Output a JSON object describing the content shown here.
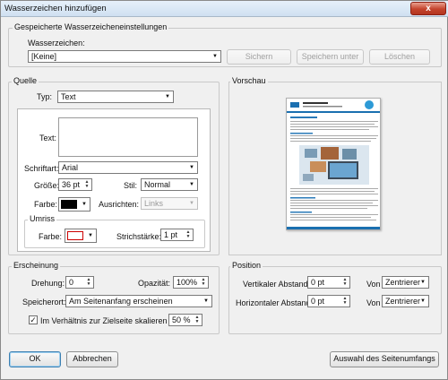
{
  "window": {
    "title": "Wasserzeichen hinzufügen",
    "close_glyph": "x"
  },
  "saved_settings": {
    "legend": "Gespeicherte Wasserzeicheneinstellungen",
    "watermark_label": "Wasserzeichen:",
    "watermark_value": "[Keine]",
    "save_button": "Sichern",
    "save_as_button": "Speichern unter",
    "delete_button": "Löschen"
  },
  "source": {
    "legend": "Quelle",
    "type_label": "Typ:",
    "type_value": "Text",
    "text_label": "Text:",
    "text_value": "",
    "font_label": "Schriftart:",
    "font_value": "Arial",
    "size_label": "Größe:",
    "size_value": "36 pt",
    "style_label": "Stil:",
    "style_value": "Normal",
    "color_label": "Farbe:",
    "color_value": "#000000",
    "align_label": "Ausrichten:",
    "align_value": "Links",
    "outline": {
      "legend": "Umriss",
      "color_label": "Farbe:",
      "color_value": "#ffffff",
      "color_border": "#cc0000",
      "stroke_label": "Strichstärke:",
      "stroke_value": "1 pt"
    }
  },
  "preview": {
    "legend": "Vorschau"
  },
  "appearance": {
    "legend": "Erscheinung",
    "rotation_label": "Drehung:",
    "rotation_value": "0",
    "opacity_label": "Opazität:",
    "opacity_value": "100%",
    "location_label": "Speicherort:",
    "location_value": "Am Seitenanfang erscheinen",
    "scale_checkbox_label": "Im Verhältnis zur Zielseite skalieren",
    "scale_checked": true,
    "scale_value": "50 %"
  },
  "position": {
    "legend": "Position",
    "vertical_label": "Vertikaler Abstand:",
    "vertical_value": "0 pt",
    "vertical_from_label": "Von",
    "vertical_from_value": "Zentrierer",
    "horizontal_label": "Horizontaler Abstand:",
    "horizontal_value": "0 pt",
    "horizontal_from_label": "Von",
    "horizontal_from_value": "Zentrierer"
  },
  "footer": {
    "ok_button": "OK",
    "cancel_button": "Abbrechen",
    "page_range_button": "Auswahl des Seitenumfangs"
  },
  "icons": {
    "dropdown": "▼",
    "spin_up": "▲",
    "spin_down": "▼",
    "check": "✓"
  }
}
